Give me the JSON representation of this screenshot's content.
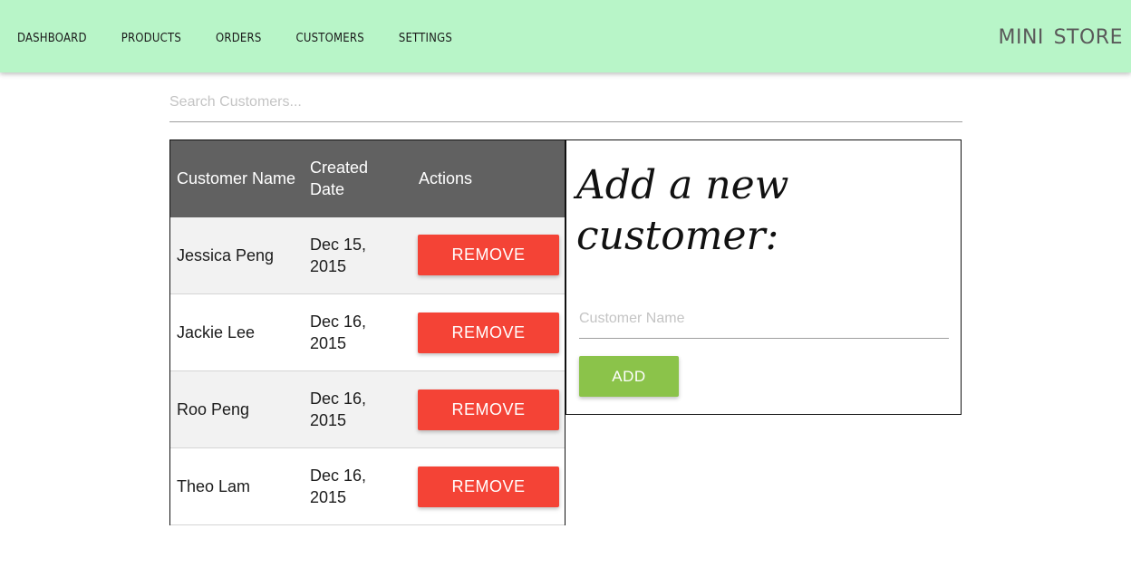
{
  "nav": {
    "links": [
      "Dashboard",
      "Products",
      "Orders",
      "Customers",
      "Settings"
    ],
    "brand": "Mini Store"
  },
  "search": {
    "placeholder": "Search Customers..."
  },
  "table": {
    "headers": {
      "name": "Customer Name",
      "created": "Created Date",
      "actions": "Actions"
    },
    "rows": [
      {
        "name": "Jessica Peng",
        "created": "Dec 15, 2015",
        "action_label": "REMOVE"
      },
      {
        "name": "Jackie Lee",
        "created": "Dec 16, 2015",
        "action_label": "REMOVE"
      },
      {
        "name": "Roo Peng",
        "created": "Dec 16, 2015",
        "action_label": "REMOVE"
      },
      {
        "name": "Theo Lam",
        "created": "Dec 16, 2015",
        "action_label": "REMOVE"
      }
    ]
  },
  "add_form": {
    "title": "Add a new customer:",
    "name_placeholder": "Customer Name",
    "add_label": "ADD"
  },
  "colors": {
    "navbar": "#b8f5c8",
    "table_header": "#616161",
    "remove": "#f44336",
    "add": "#8bc34a"
  }
}
